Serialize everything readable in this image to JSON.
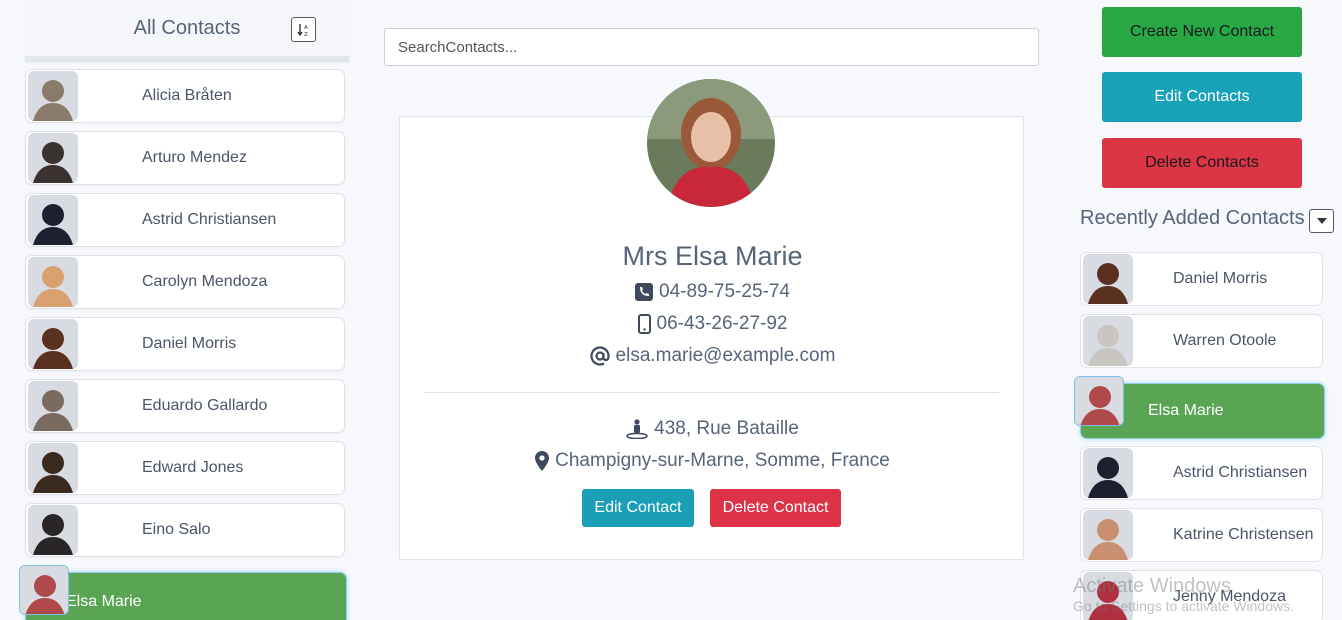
{
  "sidebar": {
    "title": "All Contacts",
    "sort_icon": "sort-alpha-icon",
    "contacts": [
      {
        "name": "Alicia Bråten",
        "color": "#8a7a6a"
      },
      {
        "name": "Arturo Mendez",
        "color": "#3a3230"
      },
      {
        "name": "Astrid Christiansen",
        "color": "#1e2030"
      },
      {
        "name": "Carolyn Mendoza",
        "color": "#d9a070"
      },
      {
        "name": "Daniel Morris",
        "color": "#5a3020"
      },
      {
        "name": "Eduardo Gallardo",
        "color": "#7a6a60"
      },
      {
        "name": "Edward Jones",
        "color": "#3a2a20"
      },
      {
        "name": "Eino Salo",
        "color": "#2a2628"
      },
      {
        "name": "Elsa Marie",
        "color": "#b04a4a",
        "active": true
      }
    ]
  },
  "search": {
    "placeholder": "SearchContacts..."
  },
  "detail": {
    "name": "Mrs Elsa Marie",
    "phone": "04-89-75-25-74",
    "cell": "06-43-26-27-92",
    "email": "elsa.marie@example.com",
    "street": "438, Rue Bataille",
    "location": "Champigny-sur-Marne, Somme, France",
    "edit_label": "Edit Contact",
    "delete_label": "Delete Contact",
    "icons": {
      "phone": "phone-square-icon",
      "cell": "mobile-icon",
      "email": "at-icon",
      "street": "street-view-icon",
      "location": "map-marker-icon"
    }
  },
  "actions": {
    "create_label": "Create New Contact",
    "edit_label": "Edit Contacts",
    "delete_label": "Delete Contacts"
  },
  "recent": {
    "title": "Recently Added Contacts",
    "caret_icon": "caret-down-icon",
    "contacts": [
      {
        "name": "Daniel Morris",
        "color": "#5a3020"
      },
      {
        "name": "Warren Otoole",
        "color": "#c8c4c0"
      },
      {
        "name": "Elsa Marie",
        "color": "#b04a4a",
        "active": true
      },
      {
        "name": "Astrid Christiansen",
        "color": "#1e2030"
      },
      {
        "name": "Katrine Christensen",
        "color": "#c89070"
      },
      {
        "name": "Jenny Mendoza",
        "color": "#b03040"
      }
    ]
  },
  "watermark": {
    "line1": "Activate Windows",
    "line2": "Go to Settings to activate Windows."
  },
  "colors": {
    "active_row": "#5aa554",
    "create": "#27a844",
    "edit": "#17a2b8",
    "delete": "#dc3545"
  }
}
